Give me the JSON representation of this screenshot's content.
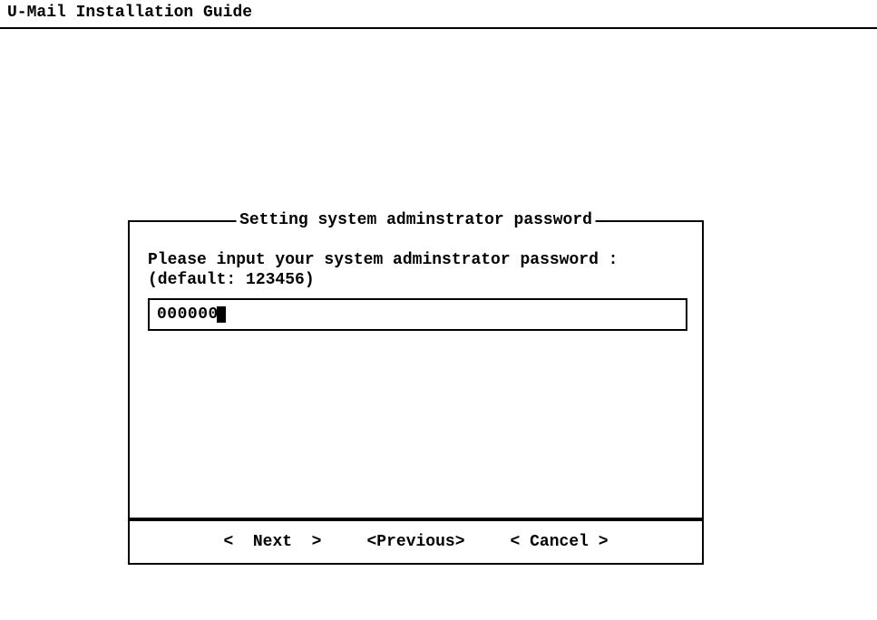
{
  "header": {
    "title": "U-Mail Installation Guide"
  },
  "dialog": {
    "title": "Setting system adminstrator password",
    "prompt_line1": "Please input your system adminstrator password :",
    "prompt_line2": "(default: 123456)",
    "input_value": "000000"
  },
  "buttons": {
    "next": "<  Next  >",
    "previous": "<Previous>",
    "cancel": "< Cancel >"
  }
}
